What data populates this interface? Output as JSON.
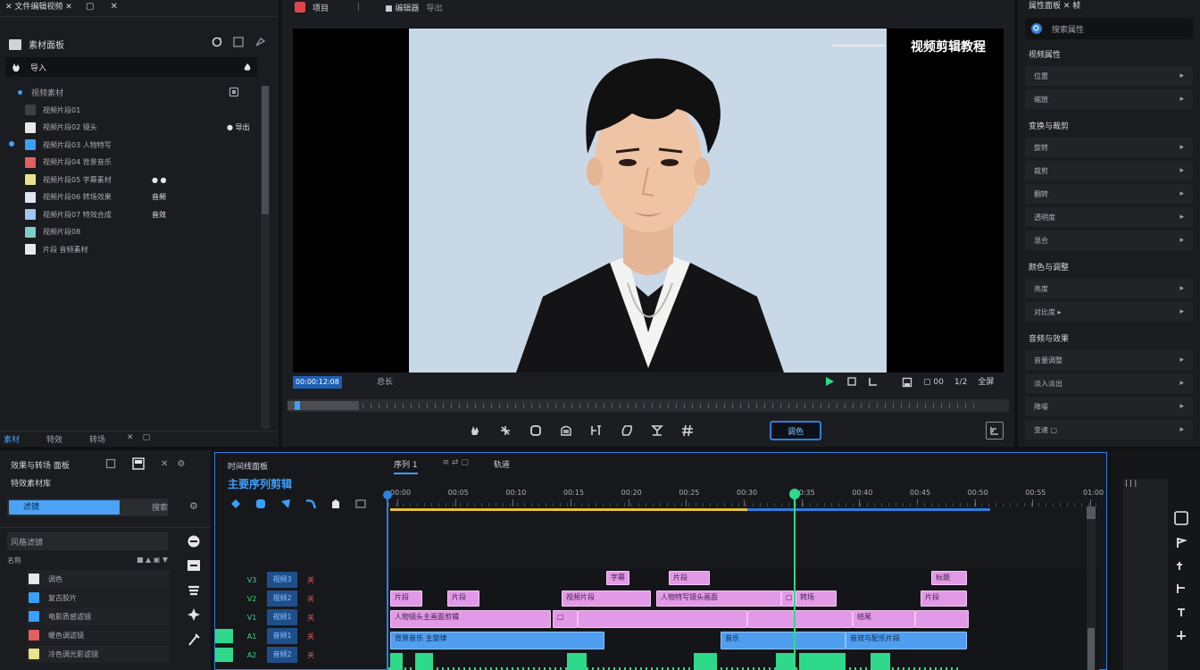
{
  "top_bar": {
    "left_title": "✕ 文件编辑视频 ✕",
    "left_controls": [
      "▢",
      "✕"
    ],
    "mid_title": "项目",
    "mid_tab": "■ 编辑器",
    "mid_sub": "导出"
  },
  "media_panel": {
    "header": "素材面板",
    "header_icons": [
      "refresh-icon",
      "grid-icon",
      "zoom-icon"
    ],
    "search_label": "导入",
    "folder_label": "视频素材",
    "items": [
      {
        "label": "视频片段01",
        "meta": "",
        "color": "#3c3f44"
      },
      {
        "label": "视频片段02 镜头",
        "meta": "● 导出",
        "color": "#e8e8e8"
      },
      {
        "label": "视频片段03 人物特写",
        "meta": "",
        "color": "#3aa0ff"
      },
      {
        "label": "视频片段04 背景音乐",
        "meta": "",
        "color": "#e06060"
      },
      {
        "label": "视频片段05 字幕素材",
        "meta": "● ●",
        "color": "#e8e28a"
      },
      {
        "label": "视频片段06 转场效果",
        "meta": "音频",
        "color": "#dde6f0"
      },
      {
        "label": "视频片段07 特效合成",
        "meta": "音效",
        "color": "#9fc6ee"
      },
      {
        "label": "视频片段08",
        "meta": "",
        "color": "#7ad0c8"
      },
      {
        "label": "片段 音频素材",
        "meta": "",
        "color": "#e8e8e8"
      }
    ],
    "footer_tabs": [
      "素材",
      "特效",
      "转场",
      "✕",
      "▢"
    ]
  },
  "preview": {
    "overlay_text": "视频剪辑教程",
    "timecode_label": "00:00:12:08",
    "duration_label": "总长",
    "controls": [
      "play-icon",
      "loop-icon",
      "mark-icon"
    ],
    "right_controls": [
      "save-icon",
      "▢ 00",
      "1/2",
      "全屏"
    ],
    "tools": [
      "hand-icon",
      "cut-icon",
      "crop-icon",
      "mask-icon",
      "split-icon",
      "pen-icon",
      "text-icon",
      "hash-icon"
    ],
    "tool_active": "调色"
  },
  "properties": {
    "title": "属性面板 ✕ 帧",
    "search_label": "搜索属性",
    "sections": [
      {
        "heading": "视频属性",
        "items": [
          "位置",
          "缩放"
        ]
      },
      {
        "heading": "变换与裁剪",
        "items": [
          "旋转",
          "裁剪",
          "翻转",
          "透明度",
          "混合"
        ]
      },
      {
        "heading": "颜色与调整",
        "items": [
          "亮度",
          "对比度 ▸"
        ]
      },
      {
        "heading": "音频与效果",
        "items": [
          "音量调整",
          "淡入淡出",
          "降噪",
          "变速 ▢"
        ]
      }
    ]
  },
  "left_bottom": {
    "title": "效果与转场 面板",
    "sub": "特效素材库",
    "search": "滤镜",
    "search_btn": "搜索",
    "list_header": "风格滤镜",
    "cols": [
      "名称",
      "■ ▲ ▣ ▼"
    ],
    "items": [
      {
        "label": "调色",
        "color": "#e8e8e8"
      },
      {
        "label": "复古胶片",
        "color": "#3aa0ff"
      },
      {
        "label": "电影质感滤镜",
        "color": "#3aa0ff"
      },
      {
        "label": "暖色调滤镜",
        "color": "#e06060"
      },
      {
        "label": "冷色调光影滤镜",
        "color": "#e8e28a"
      }
    ]
  },
  "timeline": {
    "title": "时间线面板",
    "sequence_name": "主要序列剪辑",
    "tabs": [
      "序列 1",
      "≡ ⇄ ▢",
      "轨道"
    ],
    "ruler_labels": [
      "00:00",
      "00:05",
      "00:10",
      "00:15",
      "00:20",
      "00:25",
      "00:30",
      "00:35",
      "00:40",
      "00:45",
      "00:50",
      "00:55",
      "01:00"
    ],
    "track_labels": [
      {
        "a": "V3",
        "b": "视频3",
        "c": "关"
      },
      {
        "a": "V2",
        "b": "视频2",
        "c": "关"
      },
      {
        "a": "V1",
        "b": "视频1",
        "c": "关"
      },
      {
        "a": "A1",
        "b": "音频1",
        "c": "关"
      },
      {
        "a": "A2",
        "b": "音频2",
        "c": "关"
      }
    ],
    "clips_v3": [
      "字幕",
      "片段",
      "标题"
    ],
    "clips_v2": [
      "片段",
      "片段",
      "视频片段",
      "人物特写镜头画面",
      "▢",
      "转场",
      "片段"
    ],
    "clips_v1": [
      "人物镜头主画面剪辑",
      "▢",
      "",
      "",
      "结尾",
      ""
    ],
    "clips_a1": [
      "背景音乐 主旋律",
      "音乐",
      "音效与配乐片段"
    ]
  },
  "right_strip": {
    "label": "| | |"
  }
}
